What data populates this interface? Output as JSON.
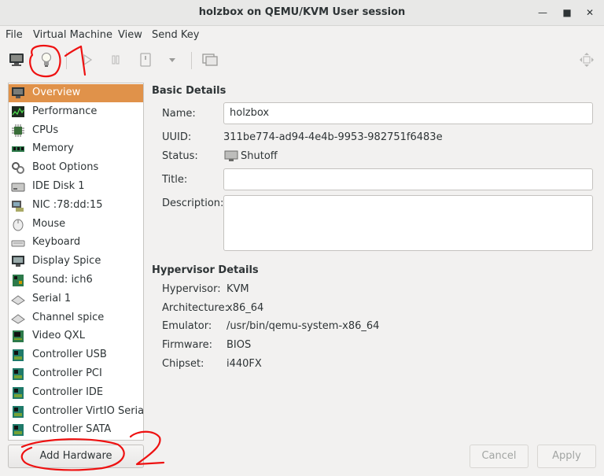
{
  "window": {
    "title": "holzbox on QEMU/KVM User session"
  },
  "menu": [
    "File",
    "Virtual Machine",
    "View",
    "Send Key"
  ],
  "toolbar": {
    "items": [
      "console-icon",
      "lightbulb-icon",
      "play-icon",
      "pause-icon",
      "power-icon",
      "dropdown-arrow-icon",
      "snapshot-icon",
      "fullscreen-icon"
    ]
  },
  "hardware": {
    "selected": "Overview",
    "items": [
      {
        "label": "Overview",
        "icon": "monitor-icon"
      },
      {
        "label": "Performance",
        "icon": "performance-graph-icon"
      },
      {
        "label": "CPUs",
        "icon": "cpu-chip-icon"
      },
      {
        "label": "Memory",
        "icon": "memory-module-icon"
      },
      {
        "label": "Boot Options",
        "icon": "gears-icon"
      },
      {
        "label": "IDE Disk 1",
        "icon": "disk-drive-icon"
      },
      {
        "label": "NIC :78:dd:15",
        "icon": "network-card-icon"
      },
      {
        "label": "Mouse",
        "icon": "mouse-icon"
      },
      {
        "label": "Keyboard",
        "icon": "keyboard-icon"
      },
      {
        "label": "Display Spice",
        "icon": "display-monitor-icon"
      },
      {
        "label": "Sound: ich6",
        "icon": "sound-card-icon"
      },
      {
        "label": "Serial 1",
        "icon": "serial-port-icon"
      },
      {
        "label": "Channel spice",
        "icon": "channel-icon"
      },
      {
        "label": "Video QXL",
        "icon": "video-card-icon"
      },
      {
        "label": "Controller USB",
        "icon": "controller-card-icon"
      },
      {
        "label": "Controller PCI",
        "icon": "controller-card-icon"
      },
      {
        "label": "Controller IDE",
        "icon": "controller-card-icon"
      },
      {
        "label": "Controller VirtIO Serial",
        "icon": "controller-card-icon"
      },
      {
        "label": "Controller SATA",
        "icon": "controller-card-icon"
      }
    ],
    "add_button": "Add Hardware"
  },
  "basic_details": {
    "heading": "Basic Details",
    "name_label": "Name:",
    "name_value": "holzbox",
    "uuid_label": "UUID:",
    "uuid_value": "311be774-ad94-4e4b-9953-982751f6483e",
    "status_label": "Status:",
    "status_value": "Shutoff",
    "title_label": "Title:",
    "title_value": "",
    "description_label": "Description:",
    "description_value": ""
  },
  "hypervisor_details": {
    "heading": "Hypervisor Details",
    "rows": [
      {
        "label": "Hypervisor:",
        "value": "KVM"
      },
      {
        "label": "Architecture:",
        "value": "x86_64"
      },
      {
        "label": "Emulator:",
        "value": "/usr/bin/qemu-system-x86_64"
      },
      {
        "label": "Firmware:",
        "value": "BIOS"
      },
      {
        "label": "Chipset:",
        "value": "i440FX"
      }
    ]
  },
  "footer": {
    "cancel": "Cancel",
    "apply": "Apply"
  },
  "annotations": {
    "mark_1": "1",
    "mark_2": "2",
    "color": "#ee1111"
  },
  "colors": {
    "selection": "#e0924a",
    "window_bg": "#f2f1f0"
  }
}
